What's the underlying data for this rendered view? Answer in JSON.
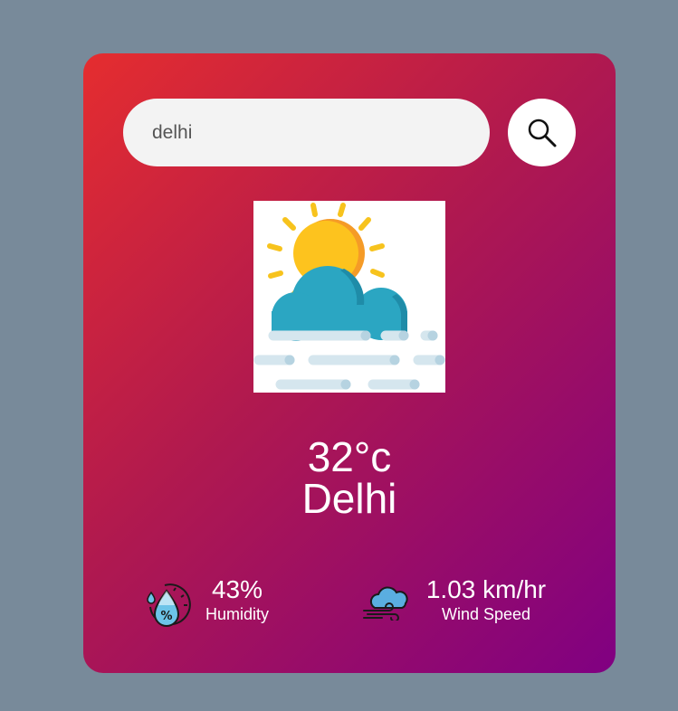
{
  "search": {
    "value": "delhi",
    "icon": "search-icon"
  },
  "weather": {
    "icon": "mist-cloud-sun-icon",
    "temperature": "32°c",
    "city": "Delhi"
  },
  "details": {
    "humidity": {
      "icon": "humidity-icon",
      "value": "43%",
      "label": "Humidity"
    },
    "wind": {
      "icon": "wind-icon",
      "value": "1.03 km/hr",
      "label": "Wind Speed"
    }
  },
  "colors": {
    "background": "#788a9a",
    "card_gradient_start": "#e52d2f",
    "card_gradient_end": "#800082",
    "text": "#ffffff"
  }
}
